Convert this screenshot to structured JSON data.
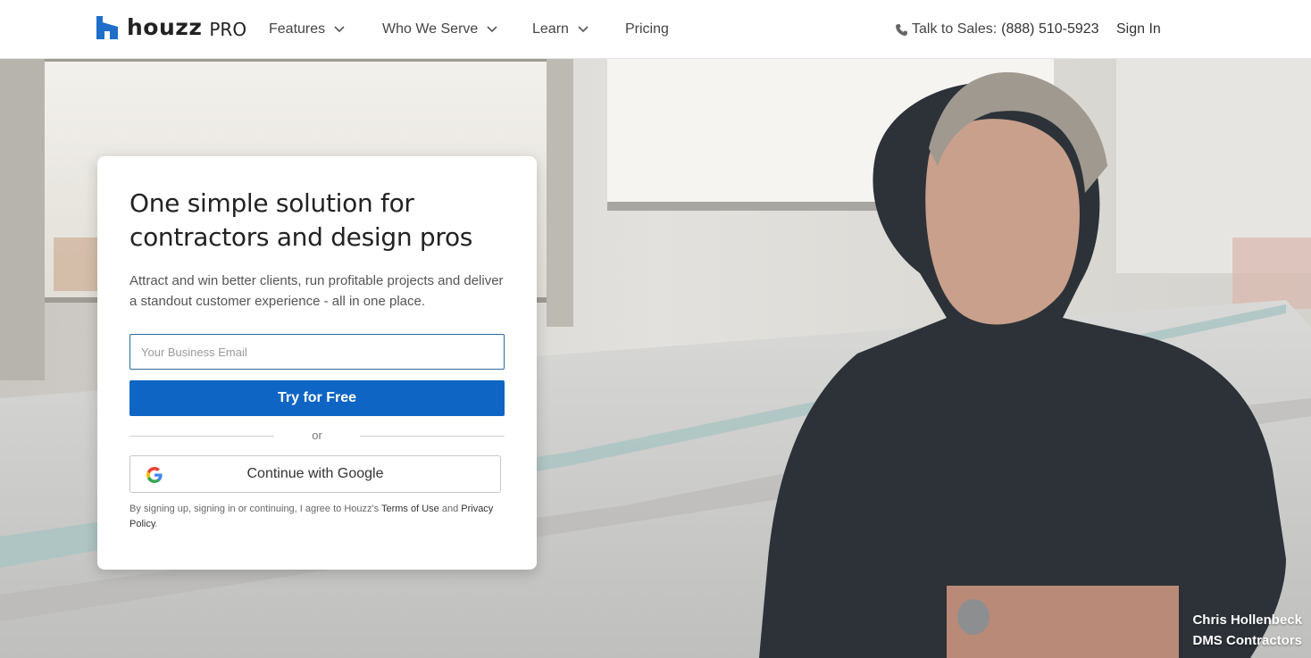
{
  "brand": {
    "name": "houzz",
    "suffix": "PRO",
    "color": "#1f6ec9"
  },
  "nav": {
    "items": [
      {
        "label": "Features",
        "dropdown": true
      },
      {
        "label": "Who We Serve",
        "dropdown": true
      },
      {
        "label": "Learn",
        "dropdown": true
      },
      {
        "label": "Pricing",
        "dropdown": false
      }
    ],
    "sales_prefix": "Talk to Sales:",
    "sales_phone": "(888) 510-5923",
    "sign_in": "Sign In"
  },
  "signup": {
    "headline": "One simple solution for contractors and design pros",
    "subtext": "Attract and win better clients, run profitable projects and deliver a standout customer experience - all in one place.",
    "email_placeholder": "Your Business Email",
    "email_value": "",
    "cta": "Try for Free",
    "divider": "or",
    "google_label": "Continue with Google",
    "legal_prefix": "By signing up, signing in or continuing, I agree to Houzz's",
    "terms": "Terms of Use",
    "legal_and": "and",
    "privacy": "Privacy Policy",
    "legal_suffix": "."
  },
  "photo_caption": {
    "name": "Chris Hollenbeck",
    "company": "DMS Contractors"
  },
  "colors": {
    "primary_button": "#0f65c4",
    "input_border": "#2a6a9a"
  }
}
